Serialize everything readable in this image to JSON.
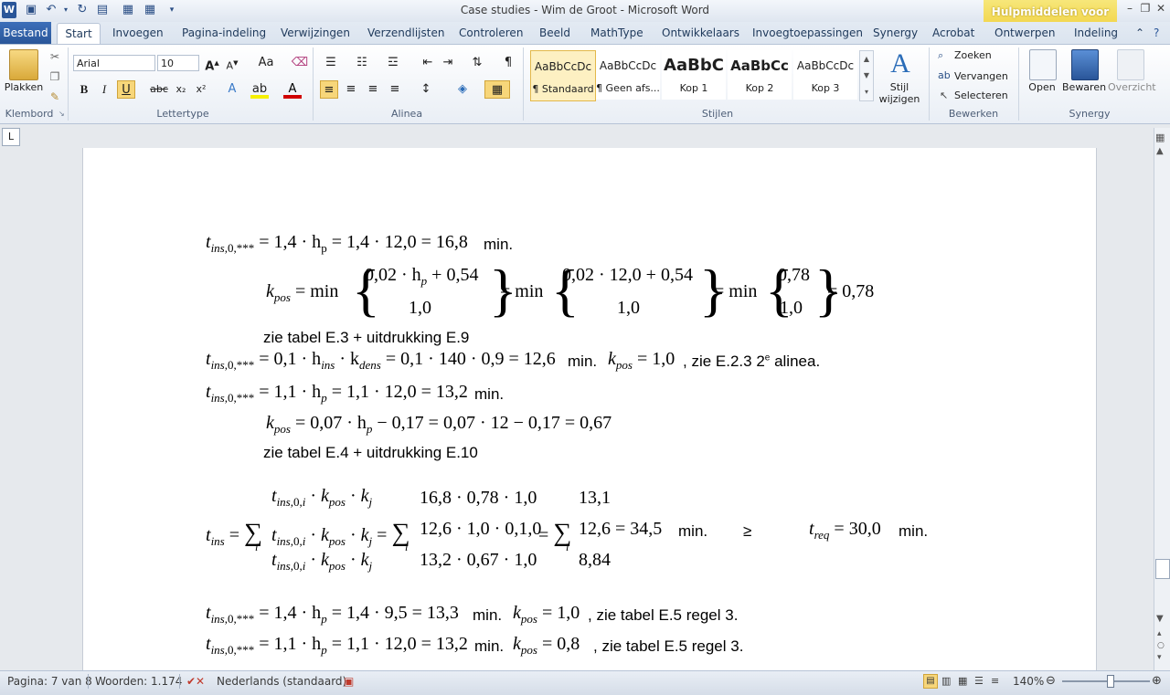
{
  "window": {
    "title": "Case studies - Wim de Groot - Microsoft Word",
    "contextual_tab": "Hulpmiddelen voor tabe..."
  },
  "tabs": {
    "file": "Bestand",
    "items": [
      "Start",
      "Invoegen",
      "Pagina-indeling",
      "Verwijzingen",
      "Verzendlijsten",
      "Controleren",
      "Beeld",
      "MathType",
      "Ontwikkelaars",
      "Invoegtoepassingen",
      "Synergy",
      "Acrobat",
      "Ontwerpen",
      "Indeling"
    ]
  },
  "ribbon": {
    "clipboard": {
      "paste": "Plakken",
      "label": "Klembord"
    },
    "font": {
      "name": "Arial",
      "size": "10",
      "label": "Lettertype"
    },
    "paragraph": {
      "label": "Alinea"
    },
    "styles": {
      "label": "Stijlen",
      "change": "Stijl wijzigen",
      "items": [
        {
          "sample": "AaBbCcDc",
          "name": "¶ Standaard"
        },
        {
          "sample": "AaBbCcDc",
          "name": "¶ Geen afs..."
        },
        {
          "sample": "AaBbC",
          "name": "Kop 1"
        },
        {
          "sample": "AaBbCc",
          "name": "Kop 2"
        },
        {
          "sample": "AaBbCcDc",
          "name": "Kop 3"
        }
      ]
    },
    "editing": {
      "find": "Zoeken",
      "replace": "Vervangen",
      "select": "Selecteren",
      "label": "Bewerken"
    },
    "synergy": {
      "open": "Open",
      "save": "Bewaren",
      "overview": "Overzicht",
      "label": "Synergy"
    }
  },
  "doc": {
    "min": "min.",
    "l1": "= 1,4 · h",
    "l1b": "= 1,4 · 12,0 = 16,8",
    "l2a": "= min",
    "l2b": "0,02 · h",
    "l2c": "+ 0,54",
    "l2d": "1,0",
    "l2e": "0,02 · 12,0 + 0,54",
    "l2f": "0,78",
    "l2g": "= 0,78",
    "l3": "zie tabel E.3 + uitdrukking E.9",
    "l4a": "= 0,1 · h",
    "l4b": "· k",
    "l4c": "= 0,1 · 140 · 0,9 = 12,6",
    "l4d": "= 1,0",
    "l4e": ", zie E.2.3 2",
    "l4sup": "e",
    "l4f": "alinea.",
    "l5a": "= 1,1 · h",
    "l5b": "= 1,1 · 12,0 = 13,2",
    "l6a": "= 0,07 · h",
    "l6b": "− 0,17 = 0,07 · 12 − 0,17 = 0,67",
    "l7": "zie tabel E.4 + uitdrukking E.10",
    "s1": "16,8 · 0,78 · 1,0",
    "s2": "12,6 · 1,0 · 0,1,0",
    "s3": "13,2 · 0,67 · 1,0",
    "r1": "13,1",
    "r2": "12,6 = 34,5",
    "r3": "8,84",
    "ge": "≥",
    "treq": "= 30,0",
    "l8a": "= 1,4 · h",
    "l8b": "= 1,4 · 9,5 = 13,3",
    "l8c": "= 1,0",
    "l8d": ", zie tabel E.5 regel 3.",
    "l9b": "= 1,1 · 12,0 = 13,2",
    "l9c": "= 0,8",
    "l9d": ", zie tabel E.5 regel 3."
  },
  "status": {
    "page": "Pagina: 7 van 8",
    "words": "Woorden: 1.174",
    "language": "Nederlands (standaard)",
    "zoom": "140%"
  }
}
